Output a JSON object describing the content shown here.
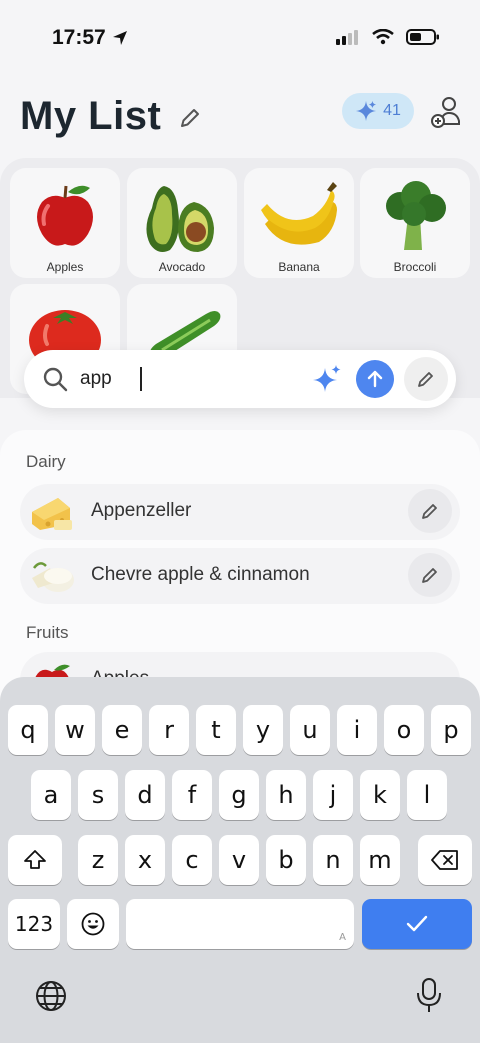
{
  "status": {
    "time": "17:57"
  },
  "header": {
    "title": "My List",
    "credits": "41"
  },
  "grid": {
    "items": [
      {
        "label": "Apples"
      },
      {
        "label": "Avocado"
      },
      {
        "label": "Banana"
      },
      {
        "label": "Broccoli"
      },
      {
        "label": ""
      },
      {
        "label": ""
      }
    ]
  },
  "search": {
    "value": "app"
  },
  "results": {
    "sections": [
      {
        "label": "Dairy"
      },
      {
        "label": "Fruits"
      }
    ],
    "rows": [
      {
        "label": "Appenzeller"
      },
      {
        "label": "Chevre apple & cinnamon"
      },
      {
        "label": "Apples"
      }
    ]
  },
  "keyboard": {
    "row1": [
      "q",
      "w",
      "e",
      "r",
      "t",
      "y",
      "u",
      "i",
      "o",
      "p"
    ],
    "row2": [
      "a",
      "s",
      "d",
      "f",
      "g",
      "h",
      "j",
      "k",
      "l"
    ],
    "row3": [
      "z",
      "x",
      "c",
      "v",
      "b",
      "n",
      "m"
    ],
    "numbers_label": "123",
    "space_hint": "A"
  },
  "colors": {
    "accent": "#4e86ef",
    "credits_bg": "#cfe7f7",
    "done_key": "#3f7ef0"
  }
}
